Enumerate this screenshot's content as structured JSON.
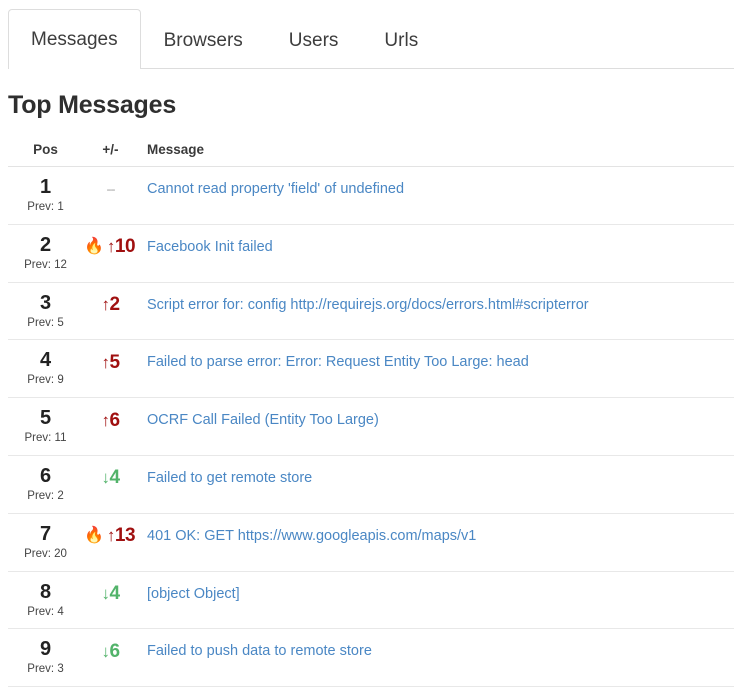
{
  "tabs": [
    {
      "label": "Messages",
      "active": true
    },
    {
      "label": "Browsers",
      "active": false
    },
    {
      "label": "Users",
      "active": false
    },
    {
      "label": "Urls",
      "active": false
    }
  ],
  "heading": "Top Messages",
  "table": {
    "columns": [
      "Pos",
      "+/-",
      "Message"
    ],
    "prev_label": "Prev:",
    "rows": [
      {
        "pos": "1",
        "prev": "Prev: 1",
        "fire": "",
        "direction": "none",
        "arrow": "",
        "delta": "--",
        "message": "Cannot read property 'field' of undefined"
      },
      {
        "pos": "2",
        "prev": "Prev: 12",
        "fire": "🔥",
        "direction": "up",
        "arrow": "↑",
        "delta": "10",
        "message": "Facebook Init failed"
      },
      {
        "pos": "3",
        "prev": "Prev: 5",
        "fire": "",
        "direction": "up",
        "arrow": "↑",
        "delta": "2",
        "message": "Script error for: config http://requirejs.org/docs/errors.html#scripterror"
      },
      {
        "pos": "4",
        "prev": "Prev: 9",
        "fire": "",
        "direction": "up",
        "arrow": "↑",
        "delta": "5",
        "message": "Failed to parse error: Error: Request Entity Too Large: head"
      },
      {
        "pos": "5",
        "prev": "Prev: 11",
        "fire": "",
        "direction": "up",
        "arrow": "↑",
        "delta": "6",
        "message": "OCRF Call Failed (Entity Too Large)"
      },
      {
        "pos": "6",
        "prev": "Prev: 2",
        "fire": "",
        "direction": "down",
        "arrow": "↓",
        "delta": "4",
        "message": "Failed to get remote store"
      },
      {
        "pos": "7",
        "prev": "Prev: 20",
        "fire": "🔥",
        "direction": "up",
        "arrow": "↑",
        "delta": "13",
        "message": "401 OK: GET https://www.googleapis.com/maps/v1"
      },
      {
        "pos": "8",
        "prev": "Prev: 4",
        "fire": "",
        "direction": "down",
        "arrow": "↓",
        "delta": "4",
        "message": "[object Object]"
      },
      {
        "pos": "9",
        "prev": "Prev: 3",
        "fire": "",
        "direction": "down",
        "arrow": "↓",
        "delta": "6",
        "message": "Failed to push data to remote store"
      }
    ]
  },
  "colors": {
    "link": "#4a87c4",
    "up": "#a01010",
    "down": "#52b36a",
    "neutral": "#cccccc",
    "border": "#dddddd",
    "text": "#333333"
  }
}
